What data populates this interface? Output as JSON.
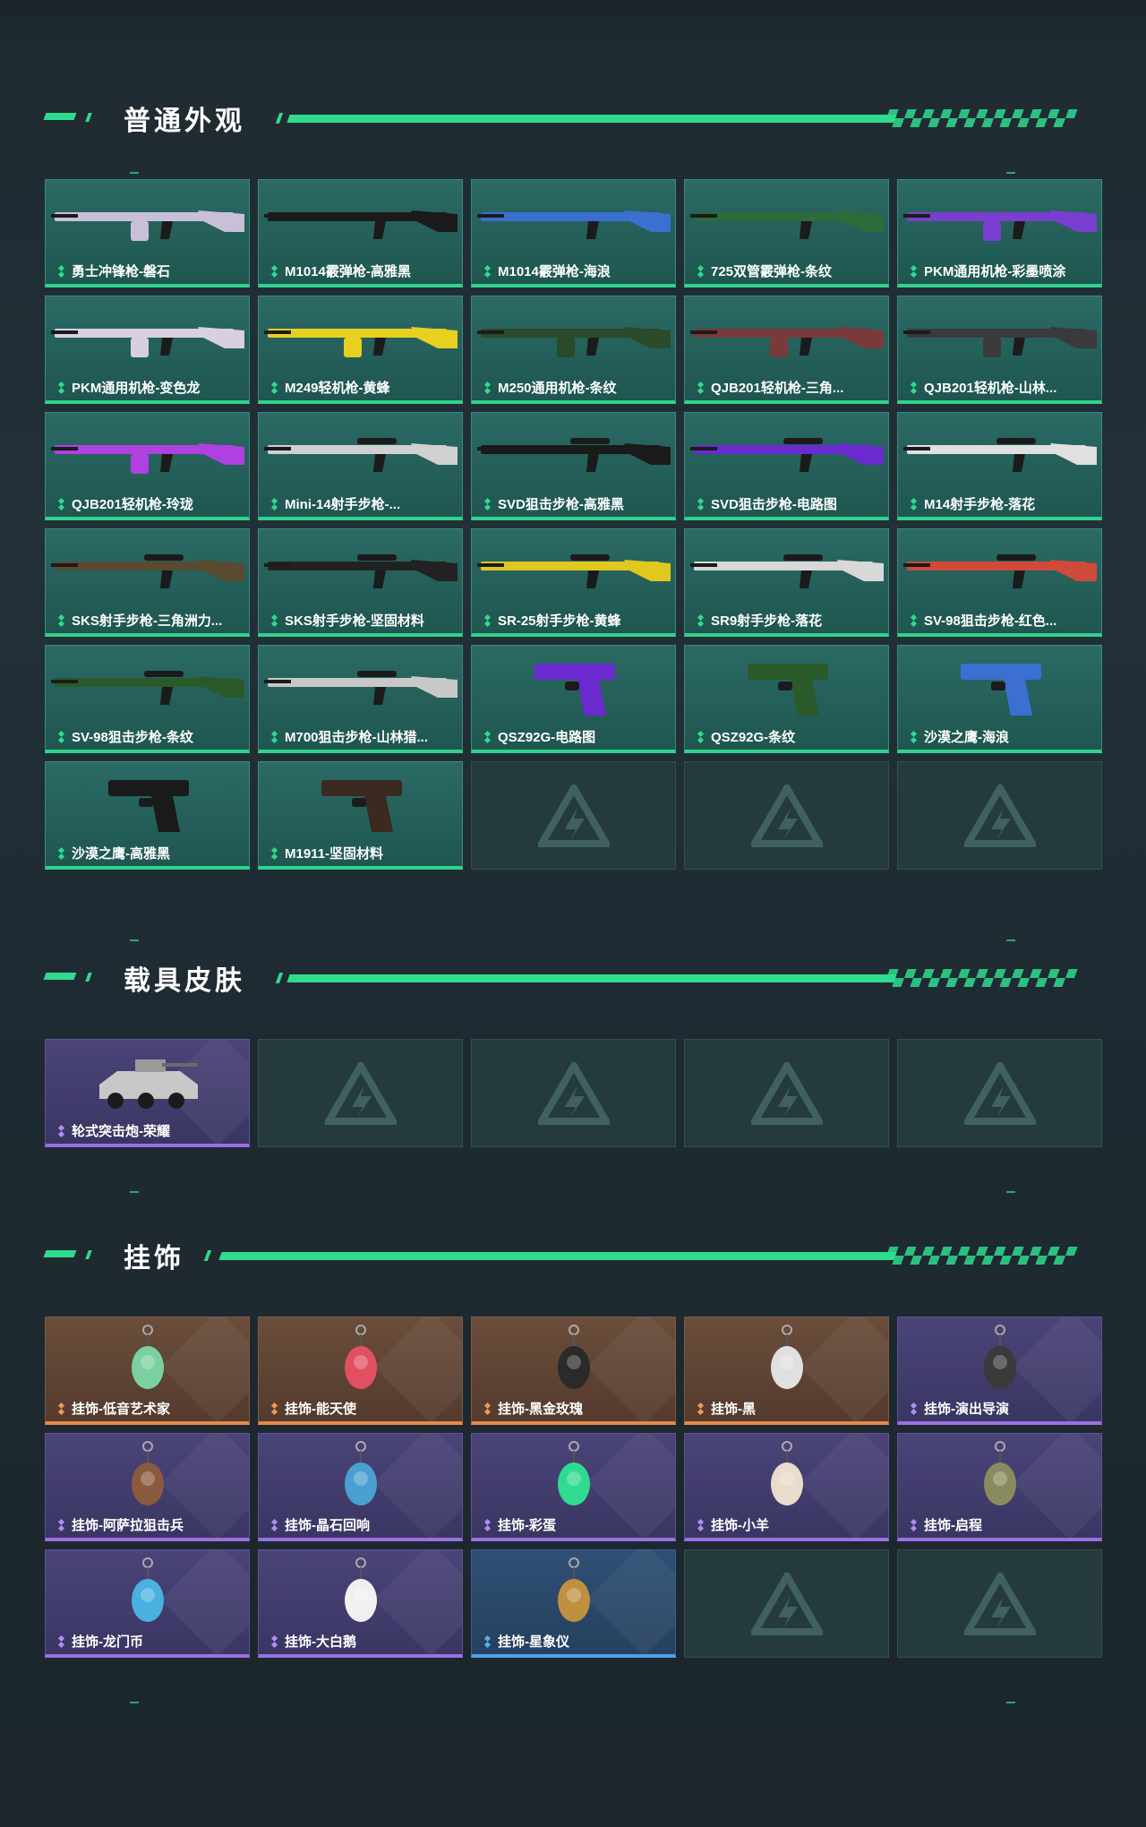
{
  "sections": [
    {
      "title": "普通外观",
      "items": [
        {
          "label": "勇士冲锋枪-磐石",
          "rarity": "green",
          "icon": "rifle-icon",
          "color": "#c8c0d8"
        },
        {
          "label": "M1014霰弹枪-高雅黑",
          "rarity": "green",
          "icon": "shotgun-icon",
          "color": "#1a1a1a"
        },
        {
          "label": "M1014霰弹枪-海浪",
          "rarity": "green",
          "icon": "shotgun-icon",
          "color": "#3b6fd0"
        },
        {
          "label": "725双管霰弹枪-条纹",
          "rarity": "green",
          "icon": "shotgun-icon",
          "color": "#2d6b3a"
        },
        {
          "label": "PKM通用机枪-彩墨喷涂",
          "rarity": "green",
          "icon": "machinegun-icon",
          "color": "#7a3fd0"
        },
        {
          "label": "PKM通用机枪-变色龙",
          "rarity": "green",
          "icon": "machinegun-icon",
          "color": "#d8d0e0"
        },
        {
          "label": "M249轻机枪-黄蜂",
          "rarity": "green",
          "icon": "machinegun-icon",
          "color": "#e8d020"
        },
        {
          "label": "M250通用机枪-条纹",
          "rarity": "green",
          "icon": "machinegun-icon",
          "color": "#2a4a2a"
        },
        {
          "label": "QJB201轻机枪-三角...",
          "rarity": "green",
          "icon": "machinegun-icon",
          "color": "#7a3a3a"
        },
        {
          "label": "QJB201轻机枪-山林...",
          "rarity": "green",
          "icon": "machinegun-icon",
          "color": "#3a3a3a"
        },
        {
          "label": "QJB201轻机枪-玲珑",
          "rarity": "green",
          "icon": "machinegun-icon",
          "color": "#b040e0"
        },
        {
          "label": "Mini-14射手步枪-...",
          "rarity": "green",
          "icon": "sniper-icon",
          "color": "#d0d0d0"
        },
        {
          "label": "SVD狙击步枪-高雅黑",
          "rarity": "green",
          "icon": "sniper-icon",
          "color": "#1a1a1a"
        },
        {
          "label": "SVD狙击步枪-电路图",
          "rarity": "green",
          "icon": "sniper-icon",
          "color": "#6a2ad0"
        },
        {
          "label": "M14射手步枪-落花",
          "rarity": "green",
          "icon": "sniper-icon",
          "color": "#e0e0e0"
        },
        {
          "label": "SKS射手步枪-三角洲力...",
          "rarity": "green",
          "icon": "sniper-icon",
          "color": "#5a4a30"
        },
        {
          "label": "SKS射手步枪-坚固材料",
          "rarity": "green",
          "icon": "sniper-icon",
          "color": "#222222"
        },
        {
          "label": "SR-25射手步枪-黄蜂",
          "rarity": "green",
          "icon": "sniper-icon",
          "color": "#e0c820"
        },
        {
          "label": "SR9射手步枪-落花",
          "rarity": "green",
          "icon": "sniper-icon",
          "color": "#d8d8d8"
        },
        {
          "label": "SV-98狙击步枪-红色...",
          "rarity": "green",
          "icon": "sniper-icon",
          "color": "#d04a3a"
        },
        {
          "label": "SV-98狙击步枪-条纹",
          "rarity": "green",
          "icon": "sniper-icon",
          "color": "#2a5a2a"
        },
        {
          "label": "M700狙击步枪-山林猎...",
          "rarity": "green",
          "icon": "sniper-icon",
          "color": "#c8c8c8"
        },
        {
          "label": "QSZ92G-电路图",
          "rarity": "green",
          "icon": "pistol-icon",
          "color": "#6a2ad0"
        },
        {
          "label": "QSZ92G-条纹",
          "rarity": "green",
          "icon": "pistol-icon",
          "color": "#2a5a2a"
        },
        {
          "label": "沙漠之鹰-海浪",
          "rarity": "green",
          "icon": "pistol-icon",
          "color": "#3b6fd0"
        },
        {
          "label": "沙漠之鹰-高雅黑",
          "rarity": "green",
          "icon": "pistol-icon",
          "color": "#1a1a1a"
        },
        {
          "label": "M1911-坚固材料",
          "rarity": "green",
          "icon": "pistol-icon",
          "color": "#3a2a20"
        },
        {
          "label": "",
          "rarity": "empty",
          "icon": "empty-slot-logo-icon"
        },
        {
          "label": "",
          "rarity": "empty",
          "icon": "empty-slot-logo-icon"
        },
        {
          "label": "",
          "rarity": "empty",
          "icon": "empty-slot-logo-icon"
        }
      ]
    },
    {
      "title": "载具皮肤",
      "items": [
        {
          "label": "轮式突击炮-荣耀",
          "rarity": "purple",
          "icon": "vehicle-icon",
          "color": "#c8c8c8"
        },
        {
          "label": "",
          "rarity": "empty",
          "icon": "empty-slot-logo-icon"
        },
        {
          "label": "",
          "rarity": "empty",
          "icon": "empty-slot-logo-icon"
        },
        {
          "label": "",
          "rarity": "empty",
          "icon": "empty-slot-logo-icon"
        },
        {
          "label": "",
          "rarity": "empty",
          "icon": "empty-slot-logo-icon"
        }
      ]
    },
    {
      "title": "挂饰",
      "items": [
        {
          "label": "挂饰-低音艺术家",
          "rarity": "orange",
          "icon": "charm-icon",
          "color": "#7ad0a0"
        },
        {
          "label": "挂饰-能天使",
          "rarity": "orange",
          "icon": "charm-icon",
          "color": "#e05060"
        },
        {
          "label": "挂饰-黑金玫瑰",
          "rarity": "orange",
          "icon": "charm-icon",
          "color": "#2a2a2a"
        },
        {
          "label": "挂饰-黑",
          "rarity": "orange",
          "icon": "charm-icon",
          "color": "#e0e0e0"
        },
        {
          "label": "挂饰-演出导演",
          "rarity": "purple",
          "icon": "charm-icon",
          "color": "#3a3a3a"
        },
        {
          "label": "挂饰-阿萨拉狙击兵",
          "rarity": "purple",
          "icon": "charm-icon",
          "color": "#8a5a40"
        },
        {
          "label": "挂饰-晶石回响",
          "rarity": "purple",
          "icon": "charm-icon",
          "color": "#4aa0d0"
        },
        {
          "label": "挂饰-彩蛋",
          "rarity": "purple",
          "icon": "charm-icon",
          "color": "#2fdb8f"
        },
        {
          "label": "挂饰-小羊",
          "rarity": "purple",
          "icon": "charm-icon",
          "color": "#e8dccc"
        },
        {
          "label": "挂饰-启程",
          "rarity": "purple",
          "icon": "charm-icon",
          "color": "#8a8a60"
        },
        {
          "label": "挂饰-龙门币",
          "rarity": "purple",
          "icon": "charm-icon",
          "color": "#4ab0e0"
        },
        {
          "label": "挂饰-大白鹅",
          "rarity": "purple",
          "icon": "charm-icon",
          "color": "#f0f0f0"
        },
        {
          "label": "挂饰-星象仪",
          "rarity": "blue",
          "icon": "charm-icon",
          "color": "#c09040"
        },
        {
          "label": "",
          "rarity": "empty",
          "icon": "empty-slot-logo-icon"
        },
        {
          "label": "",
          "rarity": "empty",
          "icon": "empty-slot-logo-icon"
        }
      ]
    }
  ]
}
